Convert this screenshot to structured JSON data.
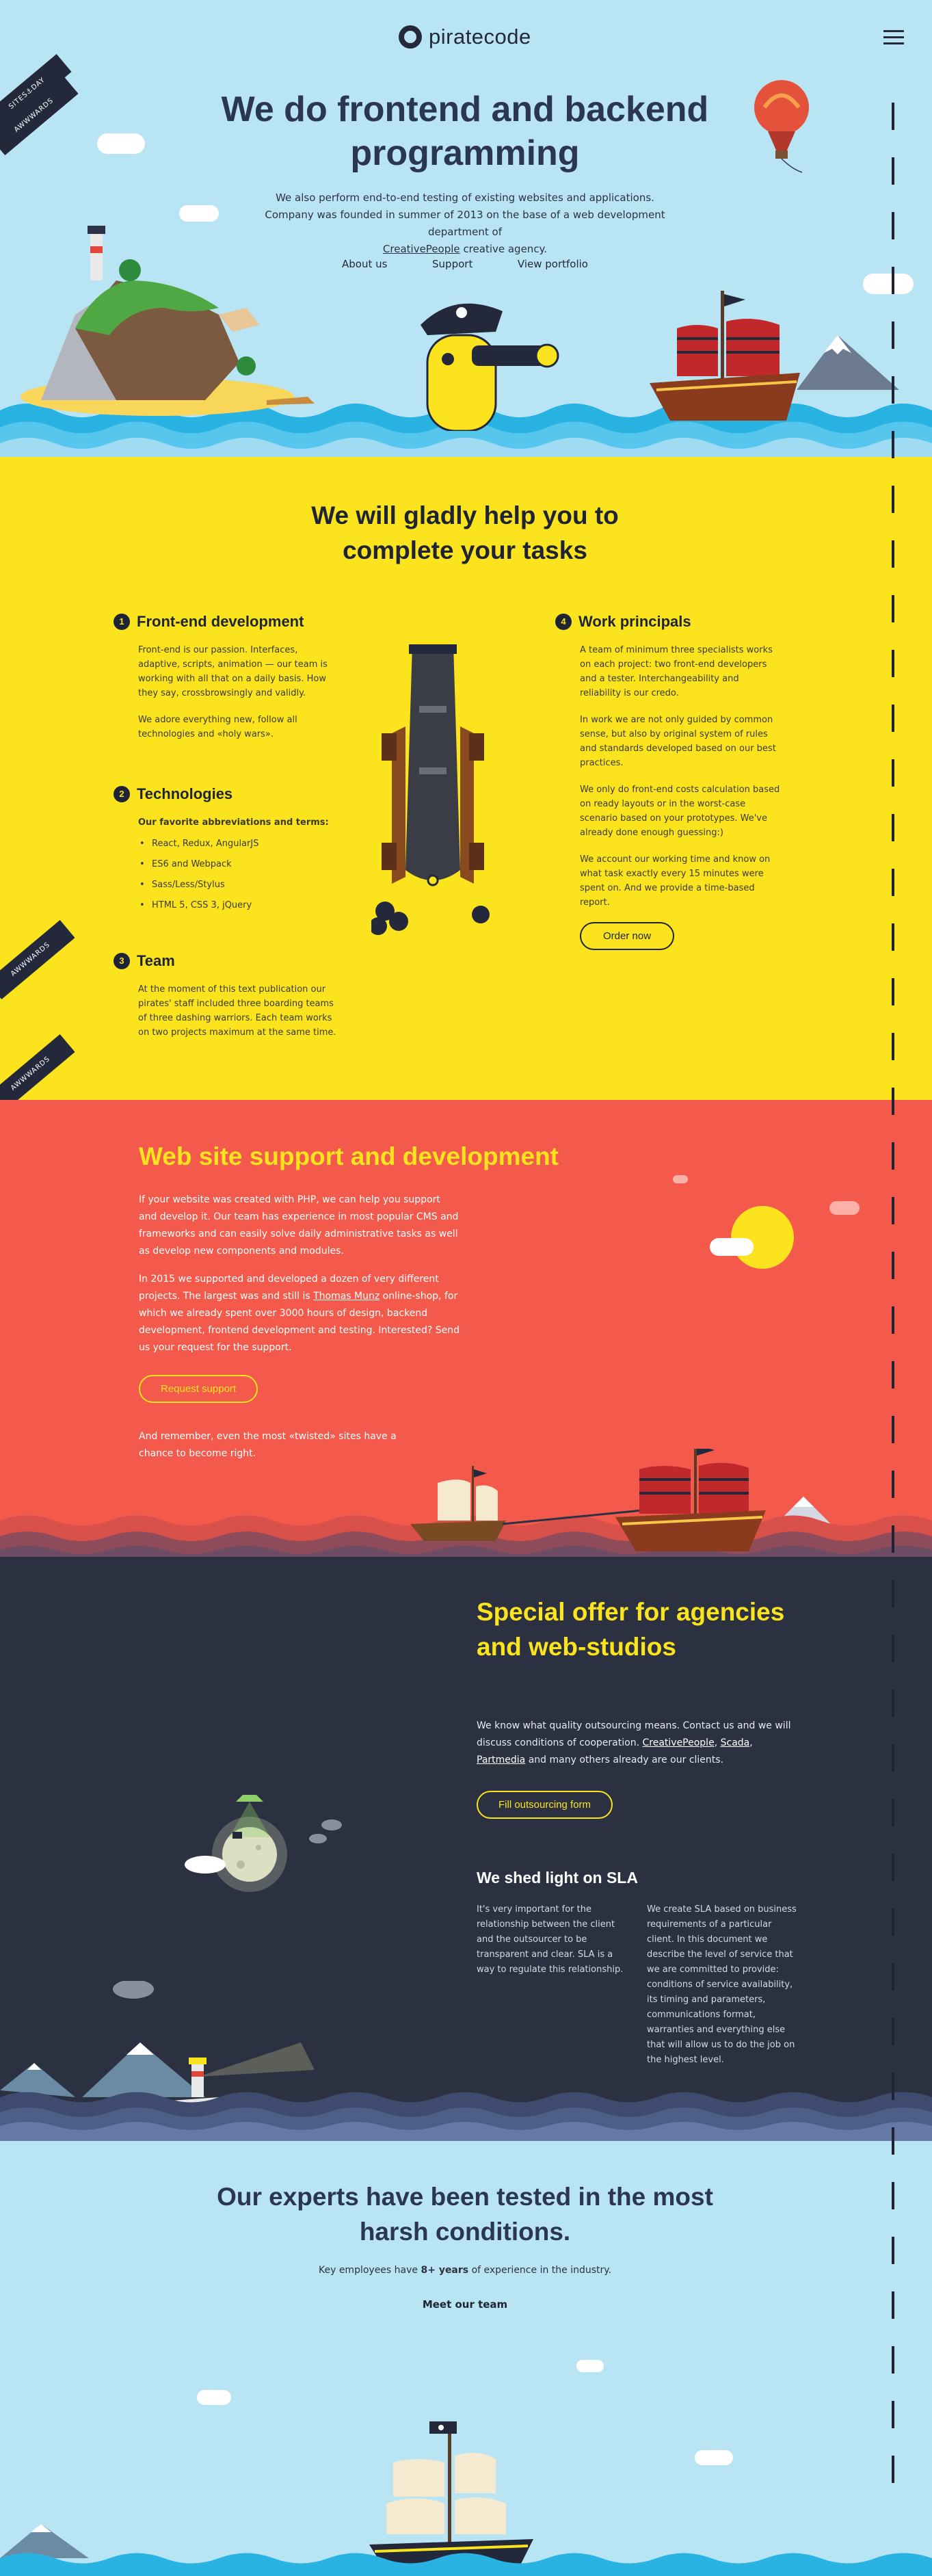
{
  "header": {
    "logo_text": "piratecode",
    "menu_icon": "hamburger-icon"
  },
  "hero": {
    "title": "We do frontend and backend programming",
    "subtitle_line1": "We also perform end-to-end testing of existing websites and applications.",
    "subtitle_line2": "Company was founded in summer of 2013 on the base of a web development department of",
    "subtitle_link": "CreativePeople",
    "subtitle_tail": "creative agency.",
    "nav": [
      "About us",
      "Support",
      "View portfolio"
    ]
  },
  "ribbons": {
    "sites": "SITES⚓DAY",
    "awwwards": "AWWWARDS"
  },
  "help": {
    "title": "We will gladly help you to complete your tasks",
    "frontend": {
      "num": "1",
      "title": "Front-end development",
      "p1": "Front-end is our passion. Interfaces, adaptive, scripts, animation — our team is working with all that on a daily basis. How they say, crossbrowsingly and validly.",
      "p2": "We adore everything new, follow all technologies and «holy wars»."
    },
    "tech": {
      "num": "2",
      "title": "Technologies",
      "lead": "Our favorite abbreviations and terms:",
      "items": [
        "React, Redux, AngularJS",
        "ES6 and Webpack",
        "Sass/Less/Stylus",
        "HTML 5, CSS 3, jQuery"
      ]
    },
    "team": {
      "num": "3",
      "title": "Team",
      "p1": "At the moment of this text publication our pirates' staff included three boarding teams of three dashing warriors. Each team works on two projects maximum at the same time."
    },
    "principles": {
      "num": "4",
      "title": "Work principals",
      "p1": "A team of minimum three specialists works on each project: two front-end developers and a tester. Interchangeability and reliability is our credo.",
      "p2": "In work we are not only guided by common sense, but also by original system of rules and standards developed based on our best practices.",
      "p3": "We only do front-end costs calculation based on ready layouts or in the worst-case scenario based on your prototypes. We've already done enough guessing:)",
      "p4": "We account our working time and know on what task exactly every 15 minutes were spent on. And we provide a time-based report.",
      "button": "Order now"
    }
  },
  "support": {
    "title": "Web site support and development",
    "p1": "If your website was created with PHP, we can help you support and develop it. Our team has experience in most popular CMS and frameworks and can easily solve daily administrative tasks as well as develop new components and modules.",
    "p2_a": "In 2015 we supported and developed a dozen of very different projects. The largest was and still is",
    "p2_link": "Thomas Munz",
    "p2_b": "online-shop, for which we already spent over 3000 hours of design, backend development, frontend development and testing. Interested? Send us your request for the support.",
    "button": "Request support",
    "p3": "And remember, even the most «twisted» sites have a chance to become right."
  },
  "offer": {
    "title": "Special offer for agencies and web-studios",
    "p1_a": "We know what quality outsourcing means. Contact us and we will discuss conditions of cooperation.",
    "links": [
      "CreativePeople",
      "Scada",
      "Partmedia"
    ],
    "p1_b": "and many others already are our clients.",
    "button": "Fill outsourcing form",
    "sla_title": "We shed light on SLA",
    "sla_left": "It's very important for the relationship between the client and the outsourcer to be transparent and clear. SLA is a way to regulate this relationship.",
    "sla_right": "We create SLA based on business requirements of a particular client. In this document we describe the level of service that we are committed to provide: conditions of service availability, its timing and parameters, communications format, warranties and everything else that will allow us to do the job on the highest level."
  },
  "experts": {
    "title": "Our experts have been tested in the most harsh conditions.",
    "text_a": "Key employees have",
    "text_bold": "8+ years",
    "text_b": "of experience in the industry.",
    "link": "Meet our team"
  },
  "colors": {
    "sky": "#b9e4f3",
    "yellow": "#fbe31e",
    "red": "#f45a4b",
    "dark": "#2b3140",
    "navy": "#2b3752"
  }
}
